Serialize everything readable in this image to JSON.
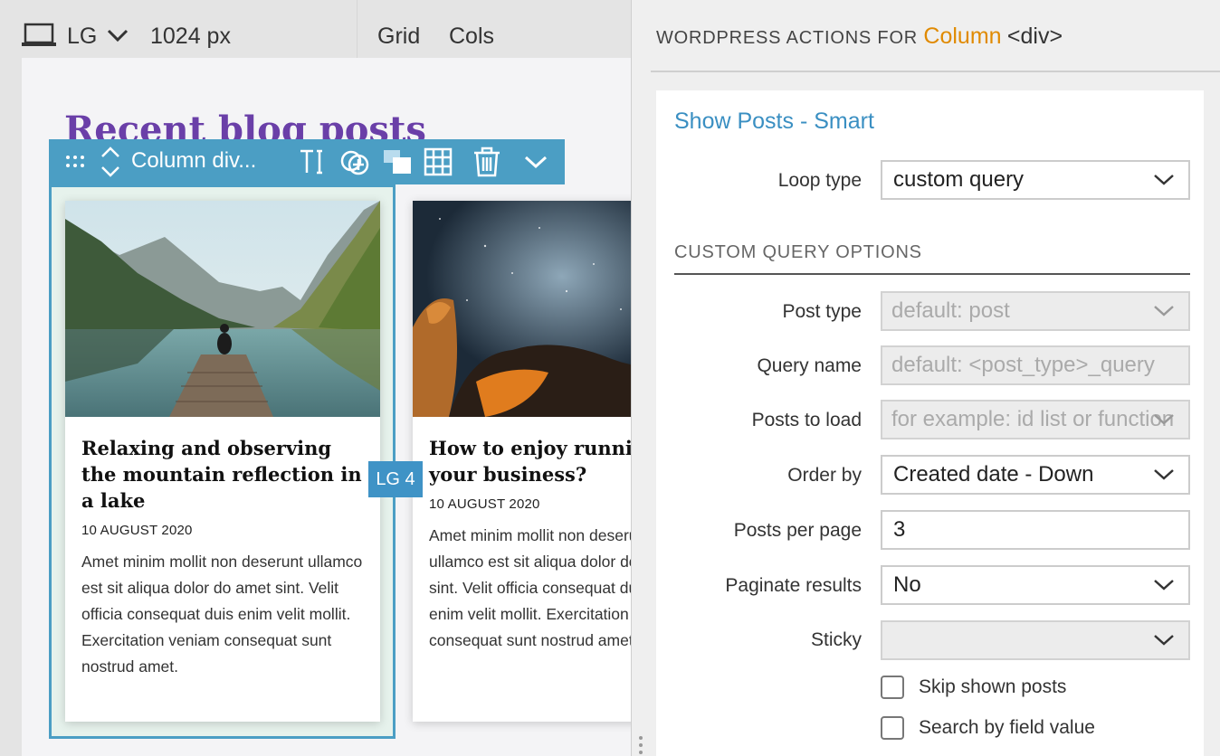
{
  "toolbar": {
    "breakpoint": "LG",
    "width": "1024 px",
    "grid_label": "Grid",
    "cols_label": "Cols"
  },
  "canvas": {
    "heading": "Recent blog posts",
    "column_badge": "LG 4",
    "block_toolbar": {
      "label": "Column div...",
      "icons": [
        "drag-handle-icon",
        "move-up-down-icon",
        "text-cursor-icon",
        "add-circle-icon",
        "layers-icon",
        "grid-icon",
        "trash-icon",
        "chevron-down-icon"
      ]
    },
    "cards": [
      {
        "title": "Relaxing and observing the mountain reflection in a lake",
        "date": "10 AUGUST 2020",
        "text": "Amet minim mollit non deserunt ullamco est sit aliqua dolor do amet sint. Velit officia consequat duis enim velit mollit. Exercitation veniam consequat sunt nostrud amet."
      },
      {
        "title": "How to enjoy running your business?",
        "date": "10 AUGUST 2020",
        "text": "Amet minim mollit non deserunt ullamco est sit aliqua dolor do amet sint. Velit officia consequat duis enim velit mollit. Exercitation veniam consequat sunt nostrud amet."
      }
    ]
  },
  "panel": {
    "heading_prefix": "WORDPRESS ACTIONS FOR",
    "element_name": "Column",
    "element_tag": "<div>",
    "action_title": "Show Posts - Smart",
    "loop_type": {
      "label": "Loop type",
      "value": "custom query"
    },
    "section_title": "CUSTOM QUERY OPTIONS",
    "post_type": {
      "label": "Post type",
      "placeholder": "default: post"
    },
    "query_name": {
      "label": "Query name",
      "placeholder": "default: <post_type>_query"
    },
    "posts_to_load": {
      "label": "Posts to load",
      "placeholder": "for example: id list or function"
    },
    "order_by": {
      "label": "Order by",
      "value": "Created date - Down"
    },
    "posts_per_page": {
      "label": "Posts per page",
      "value": "3"
    },
    "paginate": {
      "label": "Paginate results",
      "value": "No"
    },
    "sticky": {
      "label": "Sticky",
      "value": ""
    },
    "skip_shown": {
      "label": "Skip shown posts",
      "checked": false
    },
    "search_by_field": {
      "label": "Search by field value",
      "checked": false
    }
  },
  "colors": {
    "accent_blue": "#4b9ec4",
    "heading_purple": "#6a3fa8",
    "link_blue": "#3a8fc2",
    "element_orange": "#e08a00"
  }
}
